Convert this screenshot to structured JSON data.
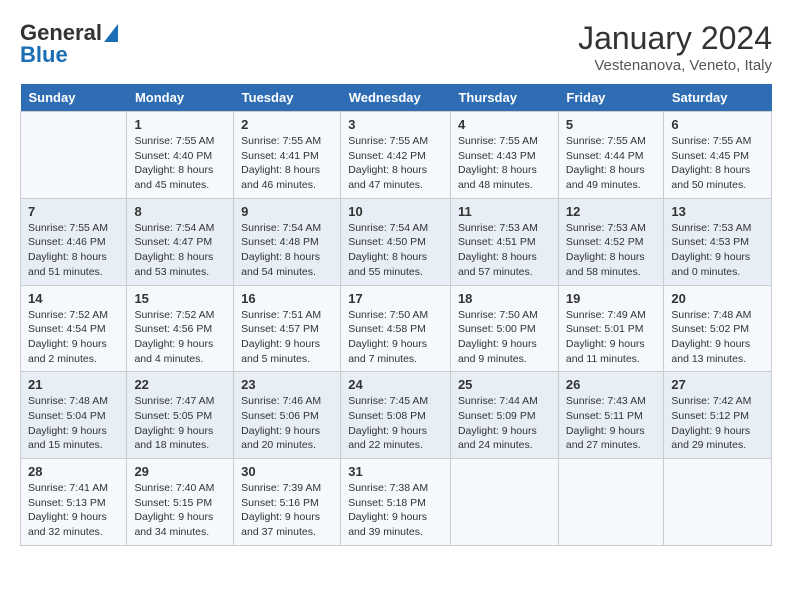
{
  "logo": {
    "general": "General",
    "blue": "Blue"
  },
  "header": {
    "month": "January 2024",
    "location": "Vestenanova, Veneto, Italy"
  },
  "weekdays": [
    "Sunday",
    "Monday",
    "Tuesday",
    "Wednesday",
    "Thursday",
    "Friday",
    "Saturday"
  ],
  "weeks": [
    [
      {
        "day": "",
        "sunrise": "",
        "sunset": "",
        "daylight": ""
      },
      {
        "day": "1",
        "sunrise": "Sunrise: 7:55 AM",
        "sunset": "Sunset: 4:40 PM",
        "daylight": "Daylight: 8 hours and 45 minutes."
      },
      {
        "day": "2",
        "sunrise": "Sunrise: 7:55 AM",
        "sunset": "Sunset: 4:41 PM",
        "daylight": "Daylight: 8 hours and 46 minutes."
      },
      {
        "day": "3",
        "sunrise": "Sunrise: 7:55 AM",
        "sunset": "Sunset: 4:42 PM",
        "daylight": "Daylight: 8 hours and 47 minutes."
      },
      {
        "day": "4",
        "sunrise": "Sunrise: 7:55 AM",
        "sunset": "Sunset: 4:43 PM",
        "daylight": "Daylight: 8 hours and 48 minutes."
      },
      {
        "day": "5",
        "sunrise": "Sunrise: 7:55 AM",
        "sunset": "Sunset: 4:44 PM",
        "daylight": "Daylight: 8 hours and 49 minutes."
      },
      {
        "day": "6",
        "sunrise": "Sunrise: 7:55 AM",
        "sunset": "Sunset: 4:45 PM",
        "daylight": "Daylight: 8 hours and 50 minutes."
      }
    ],
    [
      {
        "day": "7",
        "sunrise": "Sunrise: 7:55 AM",
        "sunset": "Sunset: 4:46 PM",
        "daylight": "Daylight: 8 hours and 51 minutes."
      },
      {
        "day": "8",
        "sunrise": "Sunrise: 7:54 AM",
        "sunset": "Sunset: 4:47 PM",
        "daylight": "Daylight: 8 hours and 53 minutes."
      },
      {
        "day": "9",
        "sunrise": "Sunrise: 7:54 AM",
        "sunset": "Sunset: 4:48 PM",
        "daylight": "Daylight: 8 hours and 54 minutes."
      },
      {
        "day": "10",
        "sunrise": "Sunrise: 7:54 AM",
        "sunset": "Sunset: 4:50 PM",
        "daylight": "Daylight: 8 hours and 55 minutes."
      },
      {
        "day": "11",
        "sunrise": "Sunrise: 7:53 AM",
        "sunset": "Sunset: 4:51 PM",
        "daylight": "Daylight: 8 hours and 57 minutes."
      },
      {
        "day": "12",
        "sunrise": "Sunrise: 7:53 AM",
        "sunset": "Sunset: 4:52 PM",
        "daylight": "Daylight: 8 hours and 58 minutes."
      },
      {
        "day": "13",
        "sunrise": "Sunrise: 7:53 AM",
        "sunset": "Sunset: 4:53 PM",
        "daylight": "Daylight: 9 hours and 0 minutes."
      }
    ],
    [
      {
        "day": "14",
        "sunrise": "Sunrise: 7:52 AM",
        "sunset": "Sunset: 4:54 PM",
        "daylight": "Daylight: 9 hours and 2 minutes."
      },
      {
        "day": "15",
        "sunrise": "Sunrise: 7:52 AM",
        "sunset": "Sunset: 4:56 PM",
        "daylight": "Daylight: 9 hours and 4 minutes."
      },
      {
        "day": "16",
        "sunrise": "Sunrise: 7:51 AM",
        "sunset": "Sunset: 4:57 PM",
        "daylight": "Daylight: 9 hours and 5 minutes."
      },
      {
        "day": "17",
        "sunrise": "Sunrise: 7:50 AM",
        "sunset": "Sunset: 4:58 PM",
        "daylight": "Daylight: 9 hours and 7 minutes."
      },
      {
        "day": "18",
        "sunrise": "Sunrise: 7:50 AM",
        "sunset": "Sunset: 5:00 PM",
        "daylight": "Daylight: 9 hours and 9 minutes."
      },
      {
        "day": "19",
        "sunrise": "Sunrise: 7:49 AM",
        "sunset": "Sunset: 5:01 PM",
        "daylight": "Daylight: 9 hours and 11 minutes."
      },
      {
        "day": "20",
        "sunrise": "Sunrise: 7:48 AM",
        "sunset": "Sunset: 5:02 PM",
        "daylight": "Daylight: 9 hours and 13 minutes."
      }
    ],
    [
      {
        "day": "21",
        "sunrise": "Sunrise: 7:48 AM",
        "sunset": "Sunset: 5:04 PM",
        "daylight": "Daylight: 9 hours and 15 minutes."
      },
      {
        "day": "22",
        "sunrise": "Sunrise: 7:47 AM",
        "sunset": "Sunset: 5:05 PM",
        "daylight": "Daylight: 9 hours and 18 minutes."
      },
      {
        "day": "23",
        "sunrise": "Sunrise: 7:46 AM",
        "sunset": "Sunset: 5:06 PM",
        "daylight": "Daylight: 9 hours and 20 minutes."
      },
      {
        "day": "24",
        "sunrise": "Sunrise: 7:45 AM",
        "sunset": "Sunset: 5:08 PM",
        "daylight": "Daylight: 9 hours and 22 minutes."
      },
      {
        "day": "25",
        "sunrise": "Sunrise: 7:44 AM",
        "sunset": "Sunset: 5:09 PM",
        "daylight": "Daylight: 9 hours and 24 minutes."
      },
      {
        "day": "26",
        "sunrise": "Sunrise: 7:43 AM",
        "sunset": "Sunset: 5:11 PM",
        "daylight": "Daylight: 9 hours and 27 minutes."
      },
      {
        "day": "27",
        "sunrise": "Sunrise: 7:42 AM",
        "sunset": "Sunset: 5:12 PM",
        "daylight": "Daylight: 9 hours and 29 minutes."
      }
    ],
    [
      {
        "day": "28",
        "sunrise": "Sunrise: 7:41 AM",
        "sunset": "Sunset: 5:13 PM",
        "daylight": "Daylight: 9 hours and 32 minutes."
      },
      {
        "day": "29",
        "sunrise": "Sunrise: 7:40 AM",
        "sunset": "Sunset: 5:15 PM",
        "daylight": "Daylight: 9 hours and 34 minutes."
      },
      {
        "day": "30",
        "sunrise": "Sunrise: 7:39 AM",
        "sunset": "Sunset: 5:16 PM",
        "daylight": "Daylight: 9 hours and 37 minutes."
      },
      {
        "day": "31",
        "sunrise": "Sunrise: 7:38 AM",
        "sunset": "Sunset: 5:18 PM",
        "daylight": "Daylight: 9 hours and 39 minutes."
      },
      {
        "day": "",
        "sunrise": "",
        "sunset": "",
        "daylight": ""
      },
      {
        "day": "",
        "sunrise": "",
        "sunset": "",
        "daylight": ""
      },
      {
        "day": "",
        "sunrise": "",
        "sunset": "",
        "daylight": ""
      }
    ]
  ]
}
